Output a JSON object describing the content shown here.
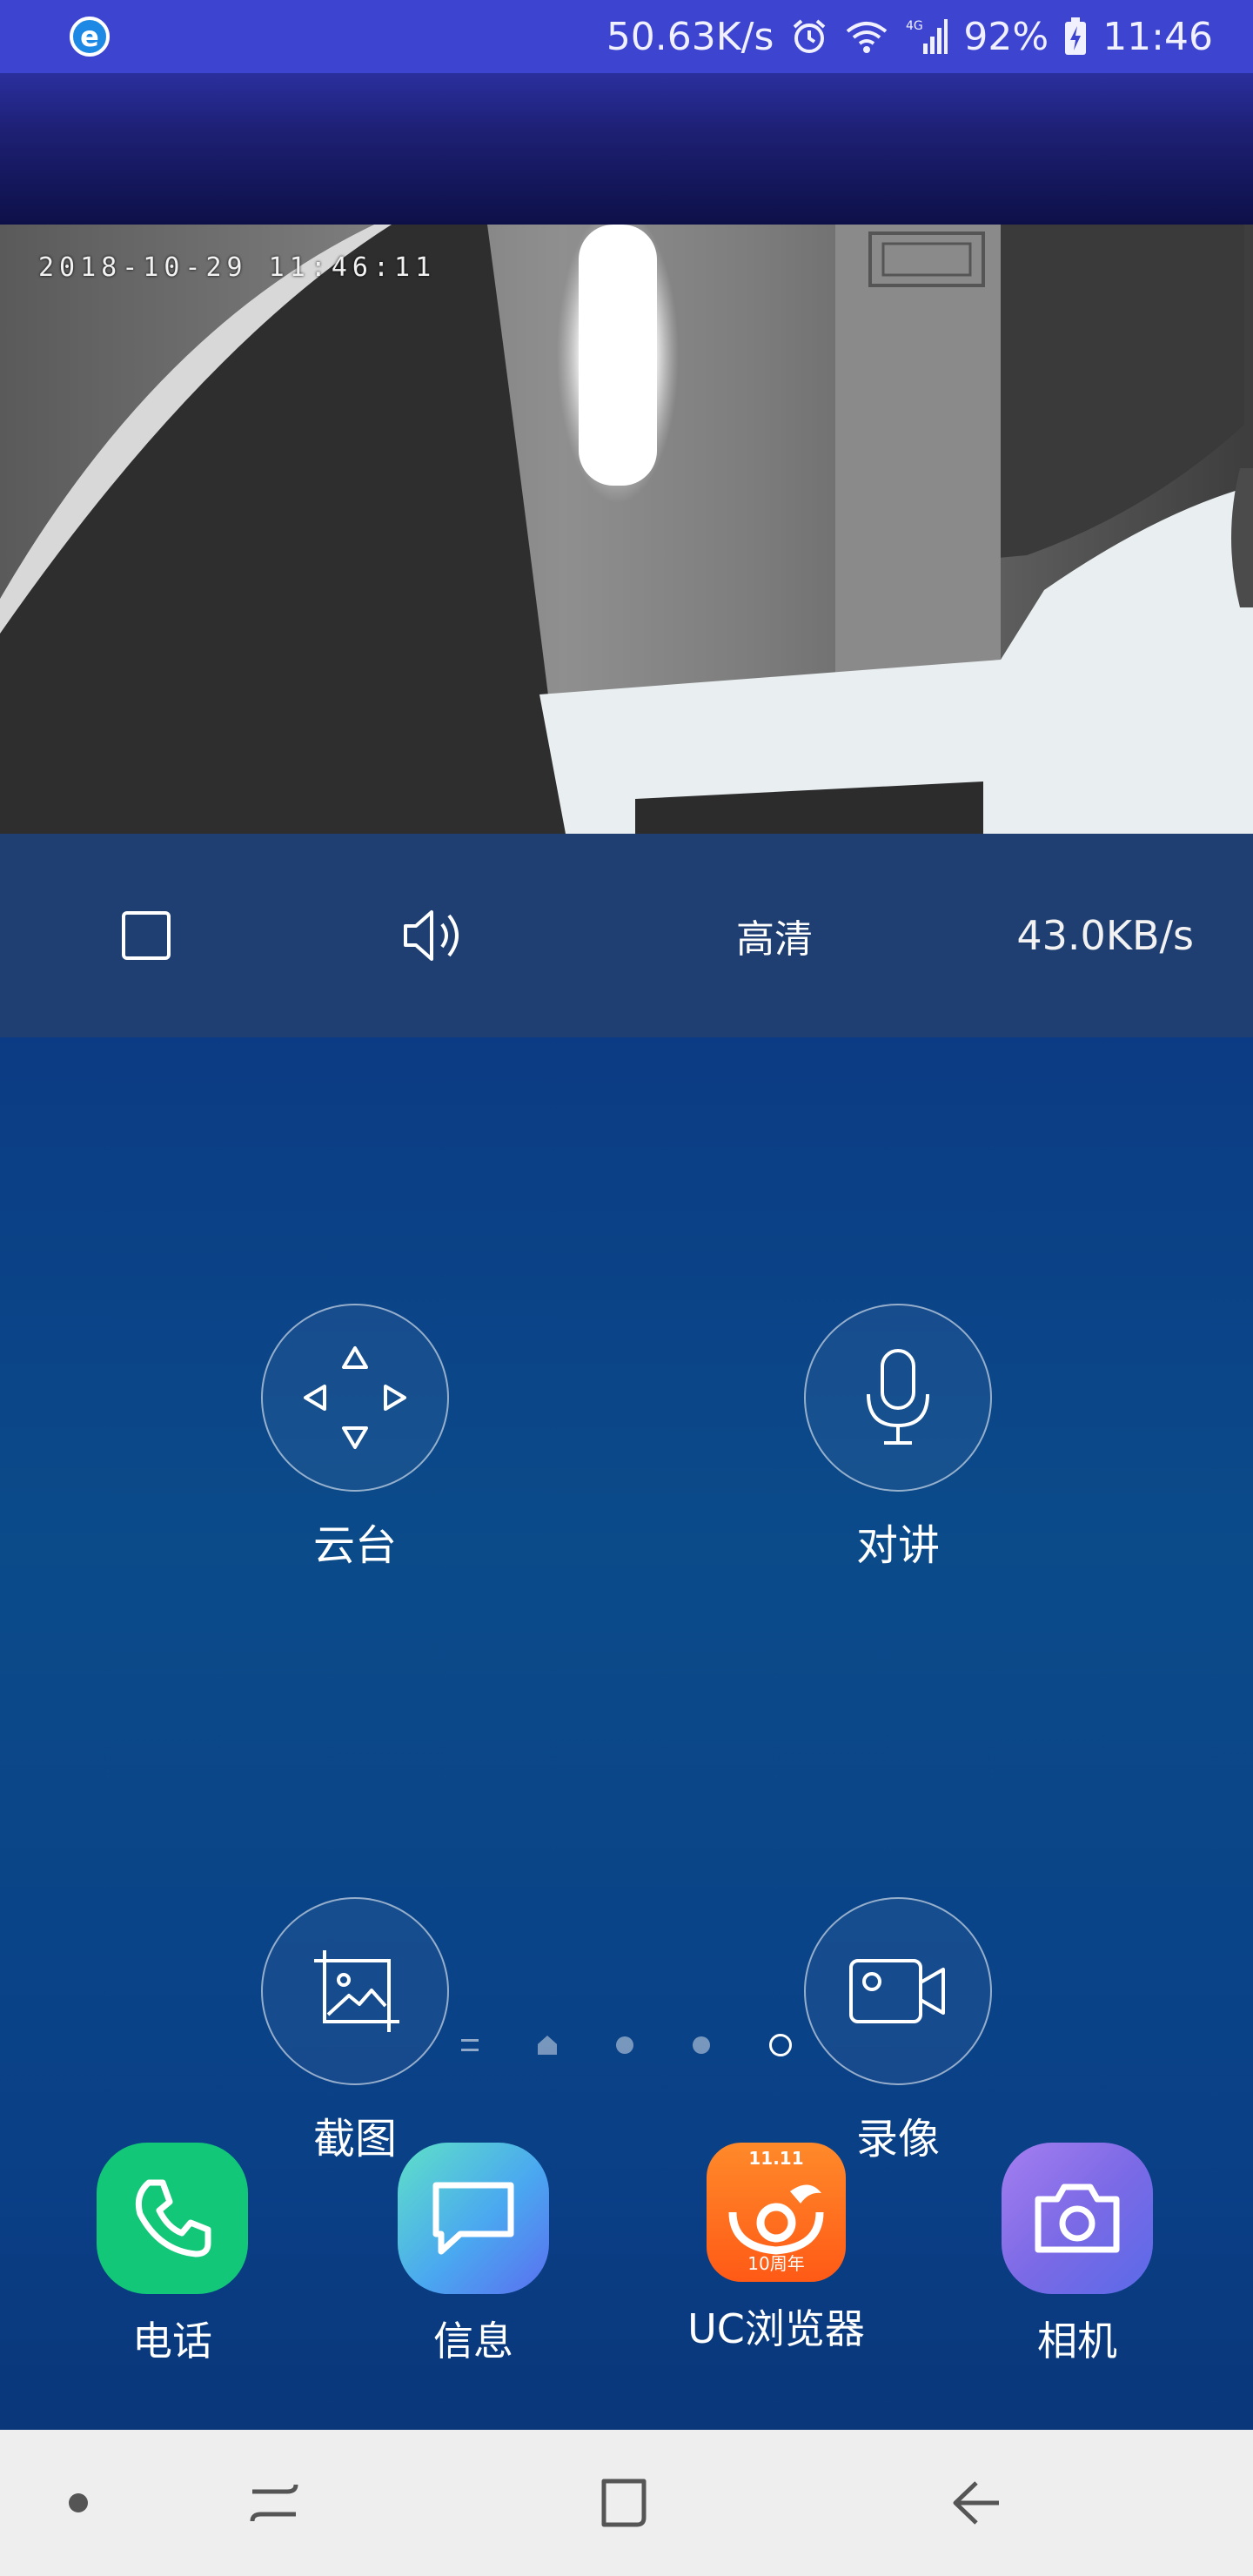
{
  "status_bar": {
    "app_badge": "e",
    "net_speed": "50.63K/s",
    "battery": "92%",
    "time": "11:46",
    "icons": [
      "alarm-icon",
      "wifi-icon",
      "signal-4g-icon",
      "battery-icon"
    ]
  },
  "video": {
    "timestamp": "2018-10-29 11:46:11"
  },
  "controls": {
    "quality_label": "高清",
    "speed": "43.0KB/s",
    "icons": [
      "stop-icon",
      "volume-icon"
    ]
  },
  "actions": [
    {
      "label": "云台",
      "icon": "ptz-arrows-icon"
    },
    {
      "label": "对讲",
      "icon": "microphone-icon"
    },
    {
      "label": "截图",
      "icon": "screenshot-icon"
    },
    {
      "label": "录像",
      "icon": "video-record-icon"
    }
  ],
  "pager": {
    "pages": 5,
    "current": 5
  },
  "dock": [
    {
      "label": "电话",
      "icon": "phone-icon",
      "color": "#12c777"
    },
    {
      "label": "信息",
      "icon": "message-icon",
      "color": "#4aa8f0"
    },
    {
      "label": "UC浏览器",
      "icon": "uc-browser-icon",
      "color": "#ff6a1a",
      "badge_top": "11.11",
      "badge_bottom": "10周年"
    },
    {
      "label": "相机",
      "icon": "camera-icon",
      "color": "#8a6fe8"
    }
  ],
  "nav_bar": {
    "icons": [
      "nav-dot-icon",
      "recent-apps-icon",
      "home-icon",
      "back-icon"
    ]
  }
}
